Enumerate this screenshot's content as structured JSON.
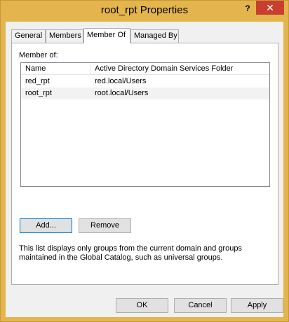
{
  "window": {
    "title": "root_rpt Properties",
    "help_label": "?",
    "close_label": "✕"
  },
  "tabs": [
    {
      "label": "General"
    },
    {
      "label": "Members"
    },
    {
      "label": "Member Of"
    },
    {
      "label": "Managed By"
    }
  ],
  "member_of": {
    "label": "Member of:",
    "columns": [
      "Name",
      "Active Directory Domain Services Folder"
    ],
    "rows": [
      {
        "name": "red_rpt",
        "folder": "red.local/Users"
      },
      {
        "name": "root_rpt",
        "folder": "root.local/Users"
      }
    ],
    "add_label": "Add...",
    "remove_label": "Remove",
    "info": "This list displays only groups from the current domain and groups maintained in the Global Catalog, such as universal groups."
  },
  "footer": {
    "ok_label": "OK",
    "cancel_label": "Cancel",
    "apply_label": "Apply"
  },
  "colors": {
    "title_bar": "#e4b54c",
    "close_button": "#c7402f"
  }
}
